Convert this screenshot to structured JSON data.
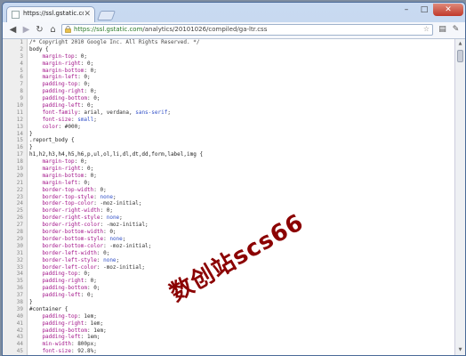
{
  "browser": {
    "tab_title": "https://ssl.gstatic.com/a...",
    "url_secure": "https://",
    "url_host": "ssl.gstatic.com",
    "url_path": "/analytics/20101026/compiled/ga-ltr.css"
  },
  "watermark": "数创站scs66",
  "lines": [
    [
      {
        "t": "/* Copyright 2010 Google Inc. All Rights Reserved. */",
        "c": "cmt"
      }
    ],
    [
      {
        "t": "body {",
        "c": "sel"
      }
    ],
    [
      {
        "t": "    margin-top",
        "c": "prop"
      },
      {
        "t": ": 0;",
        "c": "val"
      }
    ],
    [
      {
        "t": "    margin-right",
        "c": "prop"
      },
      {
        "t": ": 0;",
        "c": "val"
      }
    ],
    [
      {
        "t": "    margin-bottom",
        "c": "prop"
      },
      {
        "t": ": 0;",
        "c": "val"
      }
    ],
    [
      {
        "t": "    margin-left",
        "c": "prop"
      },
      {
        "t": ": 0;",
        "c": "val"
      }
    ],
    [
      {
        "t": "    padding-top",
        "c": "prop"
      },
      {
        "t": ": 0;",
        "c": "val"
      }
    ],
    [
      {
        "t": "    padding-right",
        "c": "prop"
      },
      {
        "t": ": 0;",
        "c": "val"
      }
    ],
    [
      {
        "t": "    padding-bottom",
        "c": "prop"
      },
      {
        "t": ": 0;",
        "c": "val"
      }
    ],
    [
      {
        "t": "    padding-left",
        "c": "prop"
      },
      {
        "t": ": 0;",
        "c": "val"
      }
    ],
    [
      {
        "t": "    font-family",
        "c": "prop"
      },
      {
        "t": ": arial, verdana, ",
        "c": "val"
      },
      {
        "t": "sans-serif",
        "c": "kw"
      },
      {
        "t": ";",
        "c": "val"
      }
    ],
    [
      {
        "t": "    font-size",
        "c": "prop"
      },
      {
        "t": ": ",
        "c": "val"
      },
      {
        "t": "small",
        "c": "kw"
      },
      {
        "t": ";",
        "c": "val"
      }
    ],
    [
      {
        "t": "    color",
        "c": "prop"
      },
      {
        "t": ": #000;",
        "c": "val"
      }
    ],
    [
      {
        "t": "}",
        "c": "sel"
      }
    ],
    [
      {
        "t": ".report_body {",
        "c": "sel"
      }
    ],
    [
      {
        "t": "}",
        "c": "sel"
      }
    ],
    [
      {
        "t": "h1,h2,h3,h4,h5,h6,p,ul,ol,li,dl,dt,dd,form,label,img {",
        "c": "sel"
      }
    ],
    [
      {
        "t": "    margin-top",
        "c": "prop"
      },
      {
        "t": ": 0;",
        "c": "val"
      }
    ],
    [
      {
        "t": "    margin-right",
        "c": "prop"
      },
      {
        "t": ": 0;",
        "c": "val"
      }
    ],
    [
      {
        "t": "    margin-bottom",
        "c": "prop"
      },
      {
        "t": ": 0;",
        "c": "val"
      }
    ],
    [
      {
        "t": "    margin-left",
        "c": "prop"
      },
      {
        "t": ": 0;",
        "c": "val"
      }
    ],
    [
      {
        "t": "    border-top-width",
        "c": "prop"
      },
      {
        "t": ": 0;",
        "c": "val"
      }
    ],
    [
      {
        "t": "    border-top-style",
        "c": "prop"
      },
      {
        "t": ": ",
        "c": "val"
      },
      {
        "t": "none",
        "c": "kw"
      },
      {
        "t": ";",
        "c": "val"
      }
    ],
    [
      {
        "t": "    border-top-color",
        "c": "prop"
      },
      {
        "t": ": -moz-initial;",
        "c": "val"
      }
    ],
    [
      {
        "t": "    border-right-width",
        "c": "prop"
      },
      {
        "t": ": 0;",
        "c": "val"
      }
    ],
    [
      {
        "t": "    border-right-style",
        "c": "prop"
      },
      {
        "t": ": ",
        "c": "val"
      },
      {
        "t": "none",
        "c": "kw"
      },
      {
        "t": ";",
        "c": "val"
      }
    ],
    [
      {
        "t": "    border-right-color",
        "c": "prop"
      },
      {
        "t": ": -moz-initial;",
        "c": "val"
      }
    ],
    [
      {
        "t": "    border-bottom-width",
        "c": "prop"
      },
      {
        "t": ": 0;",
        "c": "val"
      }
    ],
    [
      {
        "t": "    border-bottom-style",
        "c": "prop"
      },
      {
        "t": ": ",
        "c": "val"
      },
      {
        "t": "none",
        "c": "kw"
      },
      {
        "t": ";",
        "c": "val"
      }
    ],
    [
      {
        "t": "    border-bottom-color",
        "c": "prop"
      },
      {
        "t": ": -moz-initial;",
        "c": "val"
      }
    ],
    [
      {
        "t": "    border-left-width",
        "c": "prop"
      },
      {
        "t": ": 0;",
        "c": "val"
      }
    ],
    [
      {
        "t": "    border-left-style",
        "c": "prop"
      },
      {
        "t": ": ",
        "c": "val"
      },
      {
        "t": "none",
        "c": "kw"
      },
      {
        "t": ";",
        "c": "val"
      }
    ],
    [
      {
        "t": "    border-left-color",
        "c": "prop"
      },
      {
        "t": ": -moz-initial;",
        "c": "val"
      }
    ],
    [
      {
        "t": "    padding-top",
        "c": "prop"
      },
      {
        "t": ": 0;",
        "c": "val"
      }
    ],
    [
      {
        "t": "    padding-right",
        "c": "prop"
      },
      {
        "t": ": 0;",
        "c": "val"
      }
    ],
    [
      {
        "t": "    padding-bottom",
        "c": "prop"
      },
      {
        "t": ": 0;",
        "c": "val"
      }
    ],
    [
      {
        "t": "    padding-left",
        "c": "prop"
      },
      {
        "t": ": 0;",
        "c": "val"
      }
    ],
    [
      {
        "t": "}",
        "c": "sel"
      }
    ],
    [
      {
        "t": "#container {",
        "c": "sel"
      }
    ],
    [
      {
        "t": "    padding-top",
        "c": "prop"
      },
      {
        "t": ": 1em;",
        "c": "val"
      }
    ],
    [
      {
        "t": "    padding-right",
        "c": "prop"
      },
      {
        "t": ": 1em;",
        "c": "val"
      }
    ],
    [
      {
        "t": "    padding-bottom",
        "c": "prop"
      },
      {
        "t": ": 1em;",
        "c": "val"
      }
    ],
    [
      {
        "t": "    padding-left",
        "c": "prop"
      },
      {
        "t": ": 1em;",
        "c": "val"
      }
    ],
    [
      {
        "t": "    min-width",
        "c": "prop"
      },
      {
        "t": ": 800px;",
        "c": "val"
      }
    ],
    [
      {
        "t": "    font-size",
        "c": "prop"
      },
      {
        "t": ": 92.8%;",
        "c": "val"
      }
    ],
    [
      {
        "t": "}",
        "c": "sel"
      }
    ]
  ]
}
